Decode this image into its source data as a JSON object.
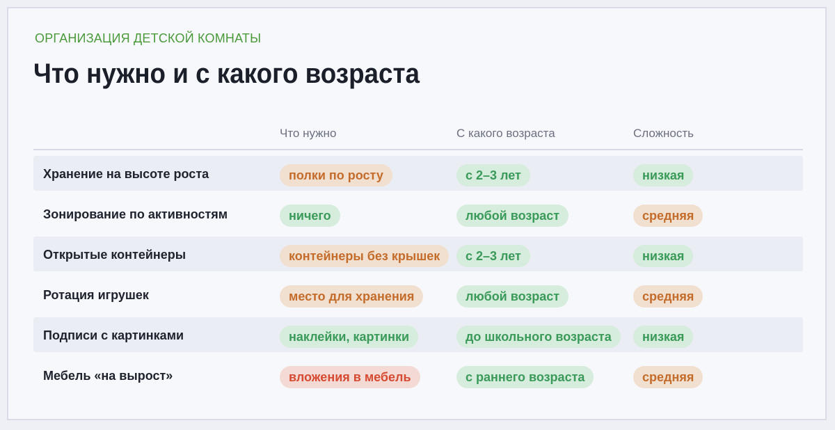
{
  "header": {
    "eyebrow": "ОРГАНИЗАЦИЯ ДЕТСКОЙ КОМНАТЫ",
    "title": "Что нужно и с какого возраста"
  },
  "columns": [
    "Что нужно",
    "С какого возраста",
    "Сложность"
  ],
  "colors": {
    "green_bg": "#d6ecdc",
    "green_text": "#3a9a59",
    "orange_bg": "#f1dfcf",
    "orange_text": "#c46c2b",
    "red_bg": "#f4dad4",
    "red_text": "#d64a33"
  },
  "rows": [
    {
      "label": "Хранение на высоте роста",
      "need": {
        "text": "полки по росту",
        "tone": "orange"
      },
      "age": {
        "text": "с 2–3 лет",
        "tone": "green"
      },
      "difficulty": {
        "text": "низкая",
        "tone": "green"
      }
    },
    {
      "label": "Зонирование по активностям",
      "need": {
        "text": "ничего",
        "tone": "green"
      },
      "age": {
        "text": "любой возраст",
        "tone": "green"
      },
      "difficulty": {
        "text": "средняя",
        "tone": "orange"
      }
    },
    {
      "label": "Открытые контейнеры",
      "need": {
        "text": "контейнеры без крышек",
        "tone": "orange"
      },
      "age": {
        "text": "с 2–3 лет",
        "tone": "green"
      },
      "difficulty": {
        "text": "низкая",
        "tone": "green"
      }
    },
    {
      "label": "Ротация игрушек",
      "need": {
        "text": "место для хранения",
        "tone": "orange"
      },
      "age": {
        "text": "любой возраст",
        "tone": "green"
      },
      "difficulty": {
        "text": "средняя",
        "tone": "orange"
      }
    },
    {
      "label": "Подписи с картинками",
      "need": {
        "text": "наклейки, картинки",
        "tone": "green"
      },
      "age": {
        "text": "до школьного возраста",
        "tone": "green"
      },
      "difficulty": {
        "text": "низкая",
        "tone": "green"
      }
    },
    {
      "label": "Мебель «на вырост»",
      "need": {
        "text": "вложения в мебель",
        "tone": "red"
      },
      "age": {
        "text": "с раннего возраста",
        "tone": "green"
      },
      "difficulty": {
        "text": "средняя",
        "tone": "orange"
      }
    }
  ]
}
